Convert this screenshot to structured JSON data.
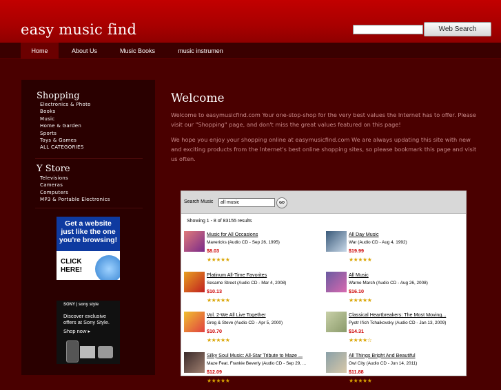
{
  "header": {
    "site_title": "easy music find",
    "search_placeholder": "",
    "search_button": "Web Search"
  },
  "nav": [
    {
      "label": "Home",
      "active": true
    },
    {
      "label": "About Us",
      "active": false
    },
    {
      "label": "Music Books",
      "active": false
    },
    {
      "label": "music instrumen",
      "active": false
    }
  ],
  "sidebar": {
    "shopping_title": "Shopping",
    "shopping_items": [
      "Electronics & Photo",
      "Books",
      "Music",
      "Home & Garden",
      "Sports",
      "Toys & Games",
      "ALL CATEGORIES"
    ],
    "ystore_title": "Y Store",
    "ystore_items": [
      "Televisions",
      "Cameras",
      "Computers",
      "MP3 & Portable Electronics"
    ],
    "ad1": {
      "line1": "Get a website",
      "line2": "just like the one",
      "line3": "you're browsing!",
      "cta1": "CLICK",
      "cta2": "HERE!"
    },
    "ad2": {
      "brand": "SONY | sony style",
      "text": "Discover exclusive offers at Sony Style.",
      "cta": "Shop now ▸"
    }
  },
  "main": {
    "title": "Welcome",
    "para1": "Welcome to easymusicfind.com Your one-stop-shop for the very best values the Internet has to offer. Please visit our \"Shopping\" page, and don't miss the great values featured on this page!",
    "para2": "We hope you enjoy your shopping online at easymusicfind.com We are always updating this site with new and exciting products from the Internet's best online shopping sites, so please bookmark this page and visit us often."
  },
  "store": {
    "search_label": "Search Music",
    "search_value": "all music",
    "go_label": "GO",
    "showing": "Showing 1 - 8 of 83155 results",
    "products": [
      {
        "title": "Music for All Occasions",
        "desc": "Mavericks (Audio CD - Sep 26, 1995)",
        "price": "$8.03",
        "rating": 4.5,
        "thumb": [
          "#e07a7a",
          "#7a2a8a"
        ]
      },
      {
        "title": "All Day Music",
        "desc": "War (Audio CD - Aug 4, 1992)",
        "price": "$19.99",
        "rating": 4.5,
        "thumb": [
          "#3a5a7a",
          "#c8d8e8"
        ]
      },
      {
        "title": "Platinum All-Time Favorites",
        "desc": "Sesame Street (Audio CD - Mar 4, 2008)",
        "price": "$10.13",
        "rating": 4.5,
        "thumb": [
          "#e8a020",
          "#c02020"
        ]
      },
      {
        "title": "All Music",
        "desc": "Warne Marsh (Audio CD - Aug 26, 2008)",
        "price": "$16.10",
        "rating": 4.5,
        "thumb": [
          "#6a5aa0",
          "#d86ab0"
        ]
      },
      {
        "title": "Vol. 2-We All Live Together",
        "desc": "Greg & Steve (Audio CD - Apr 5, 2000)",
        "price": "$10.70",
        "rating": 4.5,
        "thumb": [
          "#f0c030",
          "#e04040"
        ]
      },
      {
        "title": "Classical Heartbreakers: The Most Moving...",
        "desc": "Pyotr Il'ich Tchaikovsky (Audio CD - Jan 13, 2009)",
        "price": "$14.31",
        "rating": 4.0,
        "thumb": [
          "#c8d0a8",
          "#8a9a6a"
        ]
      },
      {
        "title": "Silky Soul Music: All-Star Tribute to Maze ...",
        "desc": "Maze Feat. Frankie Beverly (Audio CD - Sep 29, ...",
        "price": "$12.09",
        "rating": 4.5,
        "thumb": [
          "#3a2a2a",
          "#a08070"
        ]
      },
      {
        "title": "All Things Bright And Beautiful",
        "desc": "Owl City (Audio CD - Jun 14, 2011)",
        "price": "$11.88",
        "rating": 4.5,
        "thumb": [
          "#8aa0a8",
          "#d8c8a8"
        ]
      }
    ]
  }
}
